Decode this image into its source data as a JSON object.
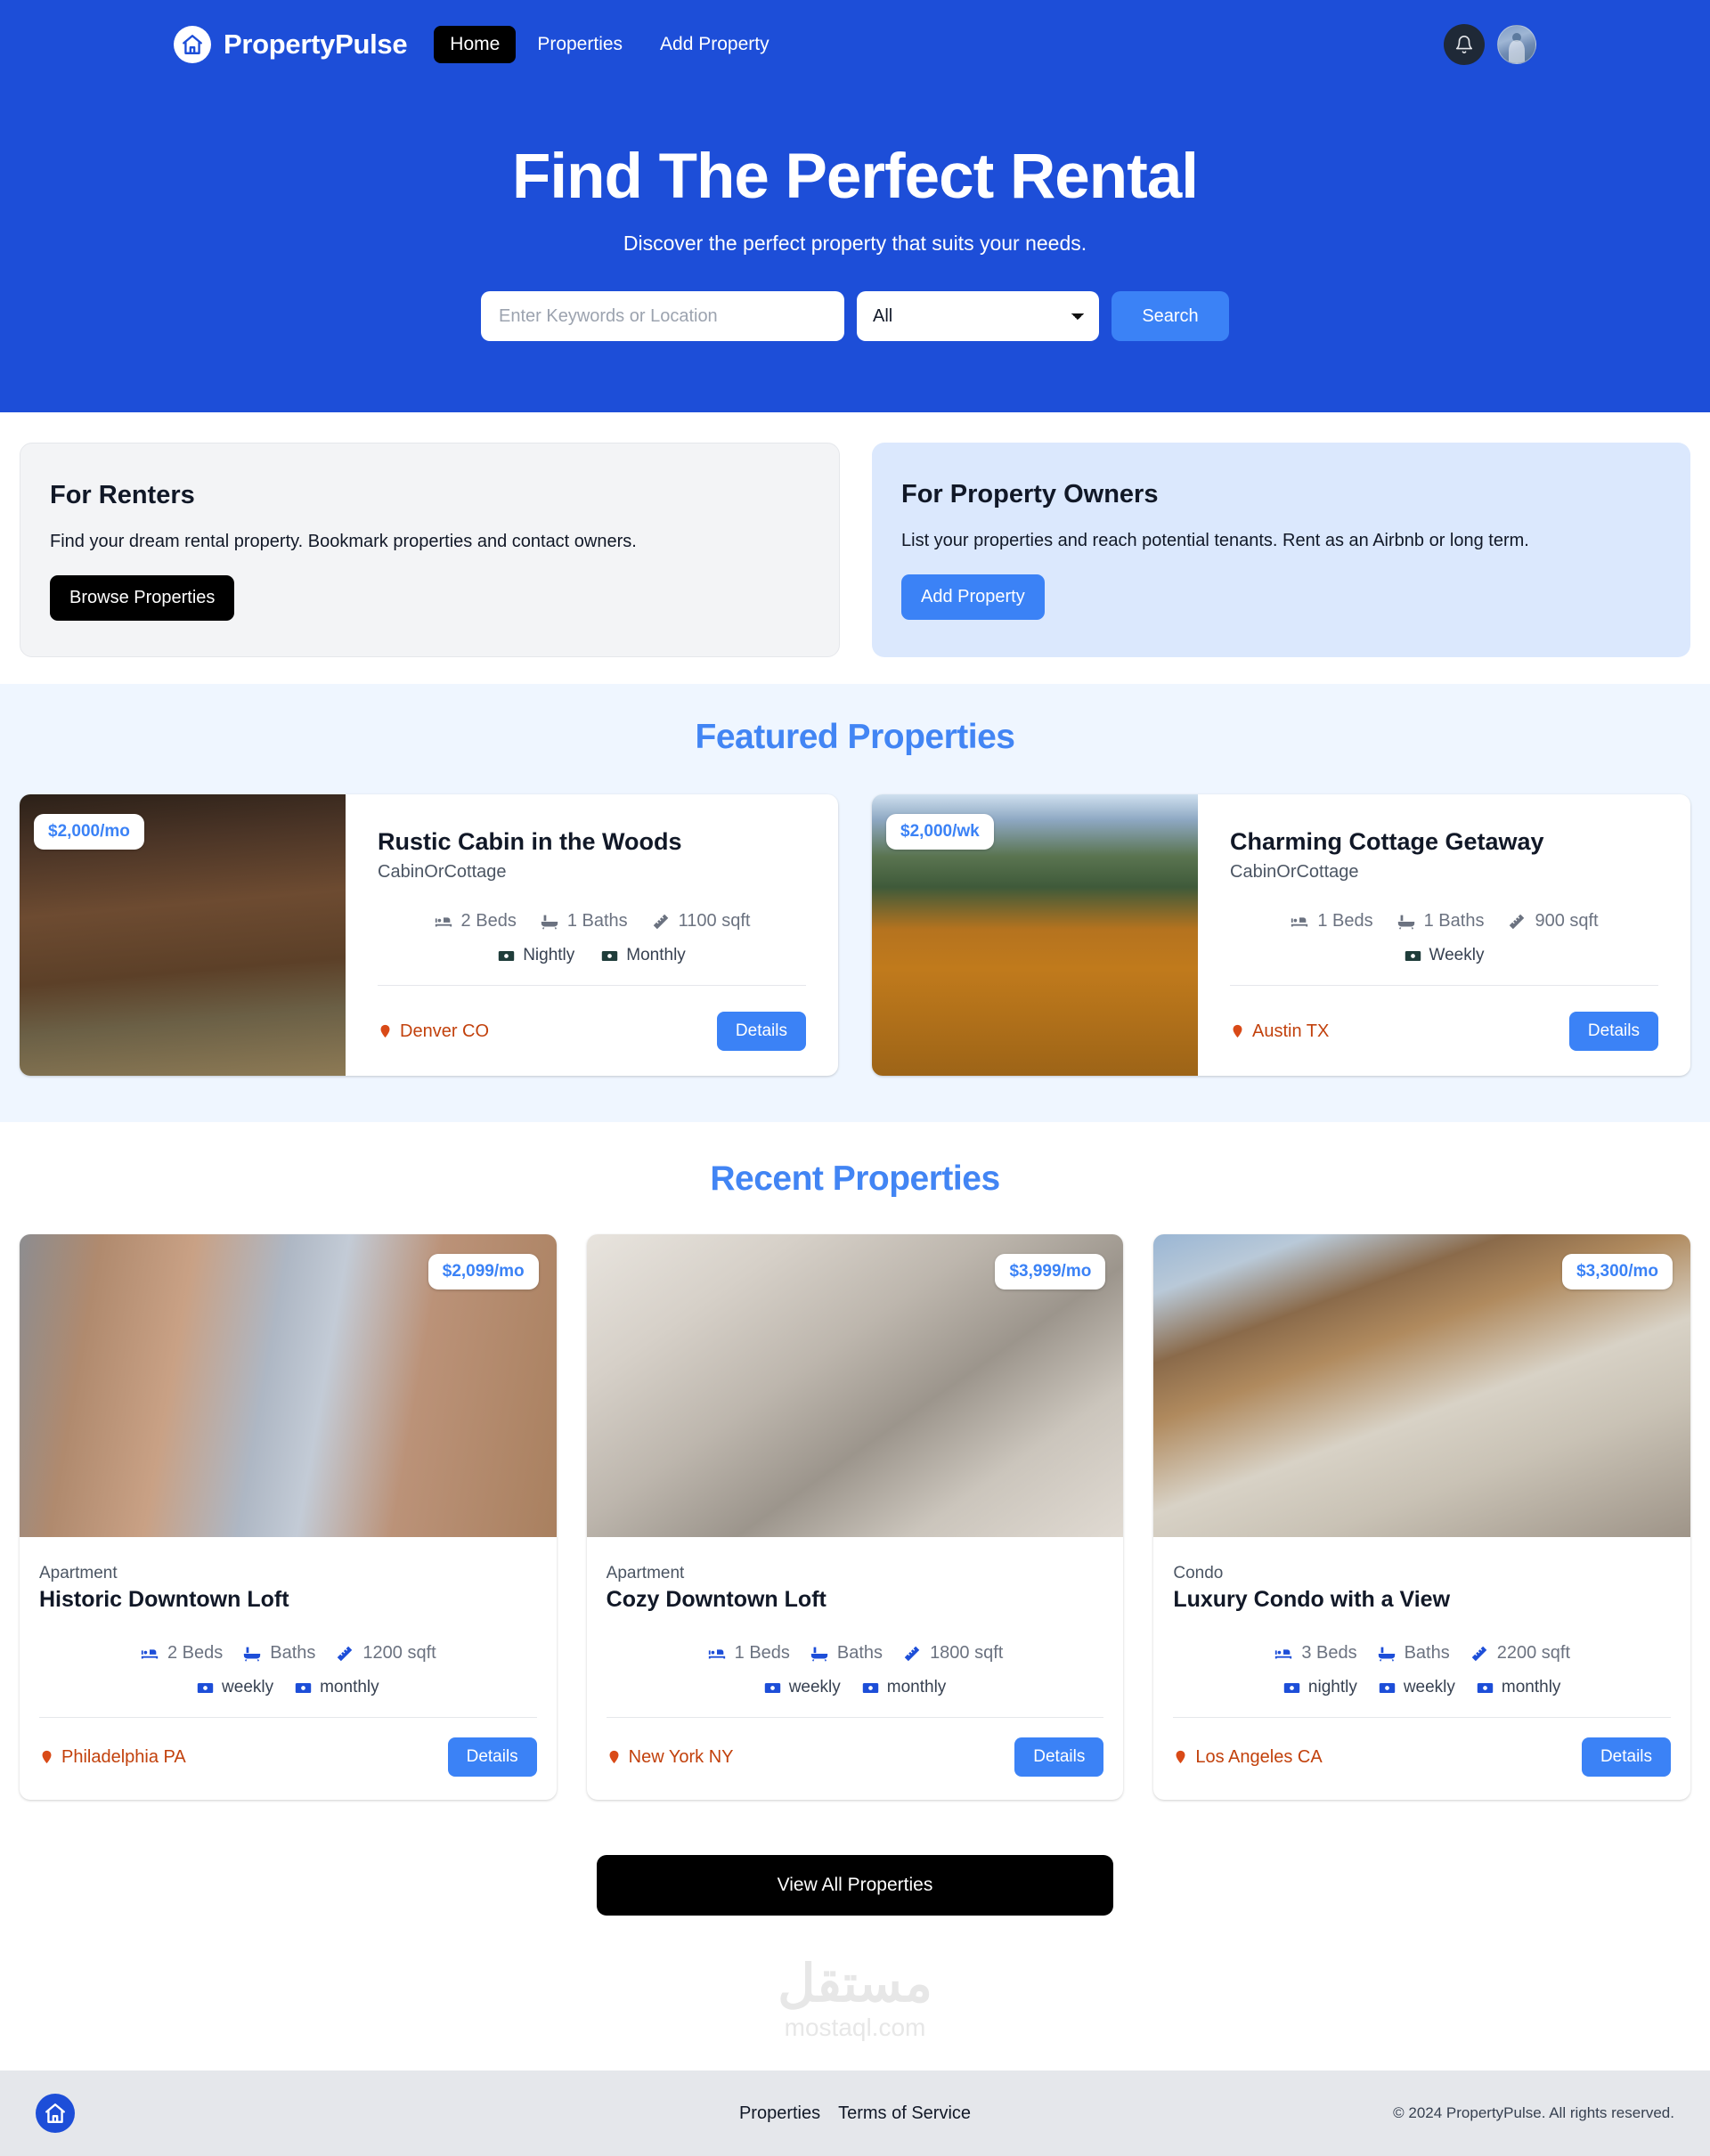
{
  "colors": {
    "brand_blue": "#1d4ed8",
    "accent_blue": "#3b82f6",
    "heading_blue": "#4285f4",
    "location_orange": "#c2410c",
    "dark": "#000000",
    "featured_bg": "#eff6ff",
    "renters_bg": "#f3f4f6",
    "owners_bg": "#dbe8fd",
    "footer_bg": "#e5e7eb"
  },
  "navbar": {
    "brand": "PropertyPulse",
    "logo_icon": "home-icon",
    "links": [
      {
        "label": "Home",
        "active": true
      },
      {
        "label": "Properties",
        "active": false
      },
      {
        "label": "Add Property",
        "active": false
      }
    ],
    "bell_icon": "bell-icon",
    "avatar_icon": "user-avatar"
  },
  "hero": {
    "title": "Find The Perfect Rental",
    "subtitle": "Discover the perfect property that suits your needs.",
    "search": {
      "placeholder": "Enter Keywords or Location",
      "value": "",
      "select_value": "All",
      "select_options": [
        "All"
      ],
      "button_label": "Search"
    }
  },
  "info_cards": [
    {
      "title": "For Renters",
      "text": "Find your dream rental property. Bookmark properties and contact owners.",
      "button": "Browse Properties"
    },
    {
      "title": "For Property Owners",
      "text": "List your properties and reach potential tenants. Rent as an Airbnb or long term.",
      "button": "Add Property"
    }
  ],
  "featured": {
    "title": "Featured Properties",
    "cards": [
      {
        "price": "$2,000/mo",
        "name": "Rustic Cabin in the Woods",
        "type": "CabinOrCottage",
        "beds": "2 Beds",
        "baths": "1 Baths",
        "sqft": "1100 sqft",
        "rates": [
          "Nightly",
          "Monthly"
        ],
        "location": "Denver CO",
        "details_label": "Details"
      },
      {
        "price": "$2,000/wk",
        "name": "Charming Cottage Getaway",
        "type": "CabinOrCottage",
        "beds": "1 Beds",
        "baths": "1 Baths",
        "sqft": "900 sqft",
        "rates": [
          "Weekly"
        ],
        "location": "Austin TX",
        "details_label": "Details"
      }
    ]
  },
  "recent": {
    "title": "Recent Properties",
    "cards": [
      {
        "price": "$2,099/mo",
        "type": "Apartment",
        "name": "Historic Downtown Loft",
        "beds": "2 Beds",
        "baths": "Baths",
        "sqft": "1200 sqft",
        "rates": [
          "weekly",
          "monthly"
        ],
        "location": "Philadelphia PA",
        "details_label": "Details"
      },
      {
        "price": "$3,999/mo",
        "type": "Apartment",
        "name": "Cozy Downtown Loft",
        "beds": "1 Beds",
        "baths": "Baths",
        "sqft": "1800 sqft",
        "rates": [
          "weekly",
          "monthly"
        ],
        "location": "New York NY",
        "details_label": "Details"
      },
      {
        "price": "$3,300/mo",
        "type": "Condo",
        "name": "Luxury Condo with a View",
        "beds": "3 Beds",
        "baths": "Baths",
        "sqft": "2200 sqft",
        "rates": [
          "nightly",
          "weekly",
          "monthly"
        ],
        "location": "Los Angeles CA",
        "details_label": "Details"
      }
    ],
    "view_all_label": "View All Properties"
  },
  "watermark": {
    "arabic": "مستقل",
    "domain": "mostaql.com"
  },
  "footer": {
    "logo_icon": "home-icon",
    "links": [
      "Properties",
      "Terms of Service"
    ],
    "copyright": "© 2024 PropertyPulse. All rights reserved."
  }
}
